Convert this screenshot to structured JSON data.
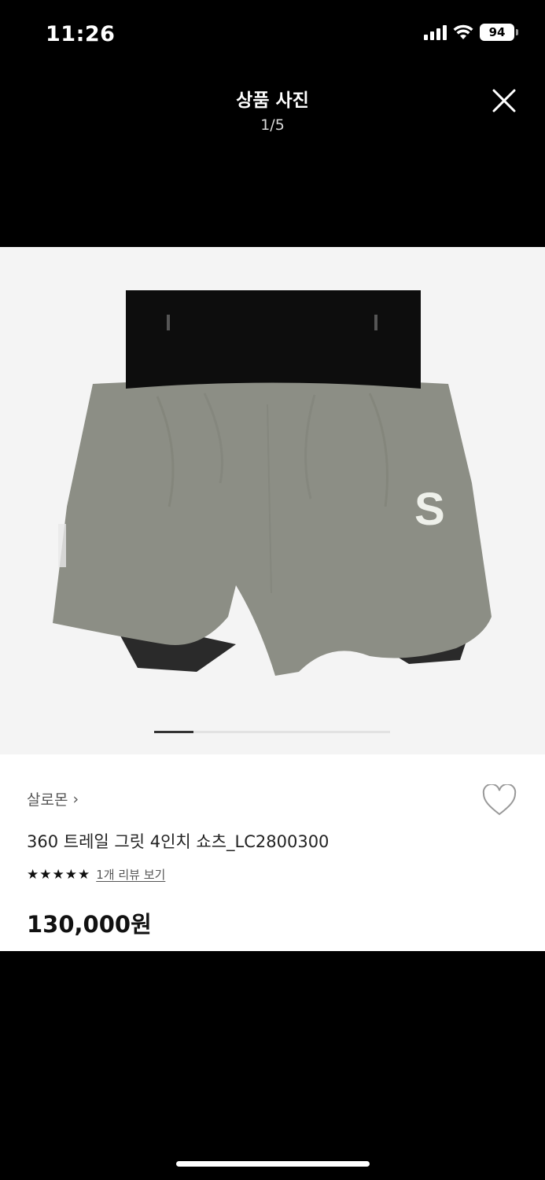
{
  "status_bar": {
    "time": "11:26",
    "battery": "94"
  },
  "viewer": {
    "title": "상품 사진",
    "counter": "1/5",
    "current_index": 1,
    "total": 5
  },
  "product": {
    "brand": "살로몬",
    "brand_chevron": "›",
    "name": "360 트레일 그릿 4인치 쇼츠_LC2800300",
    "rating_stars": 5,
    "review_link": "1개 리뷰 보기",
    "price": "130,000원",
    "logo_letter": "S"
  },
  "colors": {
    "shorts_body": "#8c8e85",
    "waistband": "#0d0d0d",
    "background": "#000000",
    "card": "#ffffff"
  },
  "icons": {
    "close": "close-icon",
    "heart": "heart-icon",
    "wifi": "wifi-icon",
    "signal": "cellular-signal-icon",
    "battery": "battery-icon"
  }
}
